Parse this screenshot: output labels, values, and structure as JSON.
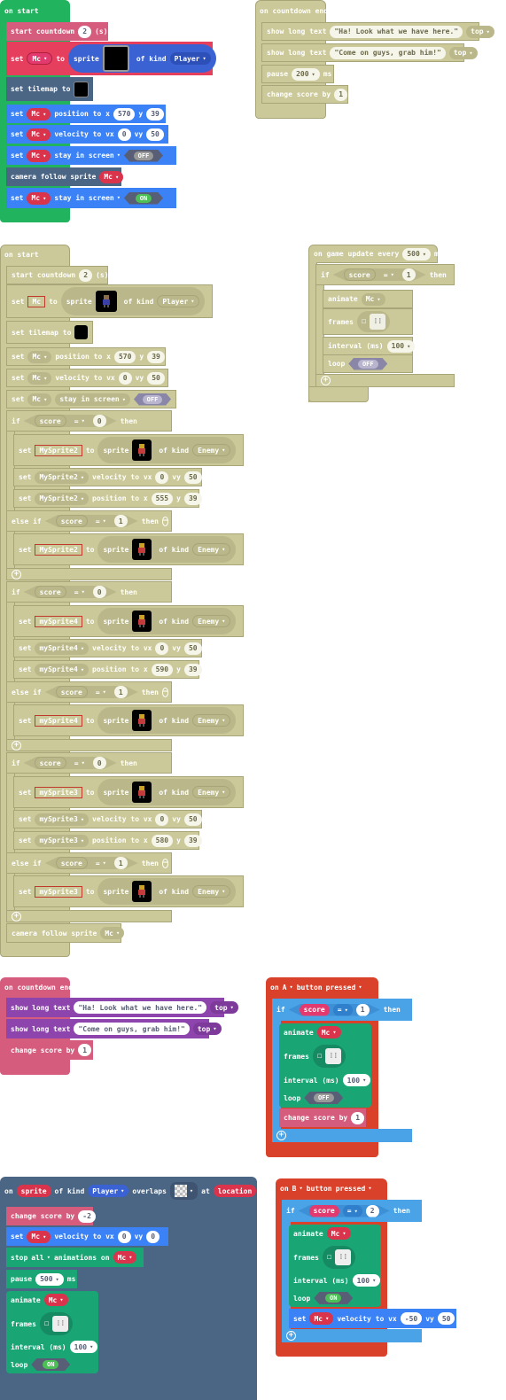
{
  "s1": {
    "hat": "on start",
    "r1": [
      "start countdown",
      "2",
      "(s)"
    ],
    "r2": [
      "set",
      "Mc",
      "to",
      "sprite",
      "of kind",
      "Player"
    ],
    "r3": "set tilemap to",
    "r4": [
      "set",
      "Mc",
      "position to x",
      "570",
      "y",
      "39"
    ],
    "r5": [
      "set",
      "Mc",
      "velocity to vx",
      "0",
      "vy",
      "50"
    ],
    "r6": [
      "set",
      "Mc",
      "stay in screen",
      "OFF"
    ],
    "r7": [
      "camera follow sprite",
      "Mc"
    ],
    "r8": [
      "set",
      "Mc",
      "stay in screen",
      "ON"
    ]
  },
  "s2": {
    "hat": "on countdown end",
    "r1": [
      "show long text",
      "\"Ha! Look what we have here.\"",
      "top"
    ],
    "r2": [
      "show long text",
      "\"Come on guys, grab him!\"",
      "top"
    ],
    "r3": [
      "pause",
      "200",
      "ms"
    ],
    "r4": [
      "change score by",
      "1"
    ]
  },
  "s3": {
    "hat": "on start",
    "start": [
      "start countdown",
      "2",
      "(s)"
    ],
    "setmc": [
      "set",
      "Mc",
      "to",
      "sprite",
      "of kind",
      "Player"
    ],
    "tile": "set tilemap to",
    "pos": [
      "set",
      "Mc",
      "position to x",
      "570",
      "y",
      "39"
    ],
    "vel": [
      "set",
      "Mc",
      "velocity to vx",
      "0",
      "vy",
      "50"
    ],
    "stay": [
      "set",
      "Mc",
      "stay in screen",
      "OFF"
    ],
    "kw": {
      "if": "if",
      "elseif": "else if",
      "then": "then",
      "score": "score",
      "eq": "=",
      "set": "set",
      "to": "to",
      "sprite": "sprite",
      "ofkind": "of kind",
      "enemy": "Enemy",
      "velvx": "velocity to vx",
      "vy": "vy",
      "posx": "position to x",
      "y": "y",
      "zero": "0",
      "one": "1",
      "fifty": "50",
      "thirtynine": "39"
    },
    "sp2": {
      "name": "MySprite2",
      "x": "555"
    },
    "sp4": {
      "name": "mySprite4",
      "x": "590"
    },
    "sp3": {
      "name": "mySprite3",
      "x": "580"
    },
    "camera": [
      "camera follow sprite",
      "Mc"
    ]
  },
  "s4": {
    "hat": [
      "on game update every",
      "500",
      "ms"
    ],
    "if": [
      "if",
      "score",
      "=",
      "1",
      "then"
    ],
    "animate": [
      "animate",
      "Mc"
    ],
    "frames": "frames",
    "interval": [
      "interval (ms)",
      "100"
    ],
    "loop": [
      "loop",
      "OFF"
    ]
  },
  "s5": {
    "hat": "on countdown end",
    "r1": [
      "show long text",
      "\"Ha! Look what we have here.\"",
      "top"
    ],
    "r2": [
      "show long text",
      "\"Come on guys, grab him!\"",
      "top"
    ],
    "r3": [
      "change score by",
      "1"
    ]
  },
  "s6": {
    "hat": [
      "on",
      "A",
      "button",
      "pressed"
    ],
    "if": [
      "if",
      "score",
      "=",
      "1",
      "then"
    ],
    "animate": [
      "animate",
      "Mc"
    ],
    "frames": "frames",
    "interval": [
      "interval (ms)",
      "100"
    ],
    "loop": [
      "loop",
      "OFF"
    ],
    "change": [
      "change score by",
      "1"
    ]
  },
  "s7": {
    "hat": [
      "on",
      "sprite",
      "of kind",
      "Player",
      "overlaps",
      "at",
      "location"
    ],
    "r1": [
      "change score by",
      "-2"
    ],
    "r2": [
      "set",
      "Mc",
      "velocity to vx",
      "0",
      "vy",
      "0"
    ],
    "r3": [
      "stop",
      "all",
      "animations on",
      "Mc"
    ],
    "r4": [
      "pause",
      "500",
      "ms"
    ],
    "animate": [
      "animate",
      "Mc"
    ],
    "frames": "frames",
    "interval": [
      "interval (ms)",
      "100"
    ],
    "loop": [
      "loop",
      "ON"
    ]
  },
  "s8": {
    "hat": [
      "on",
      "B",
      "button",
      "pressed"
    ],
    "if": [
      "if",
      "score",
      "=",
      "2",
      "then"
    ],
    "animate": [
      "animate",
      "Mc"
    ],
    "frames": "frames",
    "interval": [
      "interval (ms)",
      "100"
    ],
    "loop": [
      "loop",
      "ON"
    ],
    "vel": [
      "set",
      "Mc",
      "velocity to vx",
      "-50",
      "vy",
      "50"
    ]
  },
  "colors": {
    "loops": "#22b35e",
    "sprites": "#e63e5d",
    "scene": "#4b6584",
    "info": "#d55c7c",
    "game": "#8e44ad",
    "controller": "#d9412b",
    "logic": "#4aa3e6",
    "animation": "#1aa575",
    "disabled": "#cbc999"
  }
}
